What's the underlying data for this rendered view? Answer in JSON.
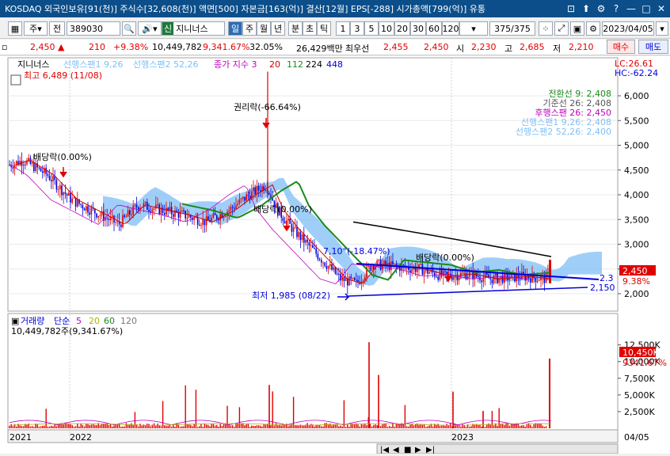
{
  "title_bar": {
    "text": "KOSDAQ 외국인보유[91(천)] 주식수[32,608(천)] 액면[500] 자본금[163(억)] 결산[12월] EPS[-288] 시가총액[799(억)] 유통",
    "buttons": [
      "restore-icon",
      "pin-icon",
      "settings-icon",
      "help-icon",
      "minimize-icon",
      "maximize-icon",
      "close-icon"
    ],
    "button_glyphs": [
      "⊡",
      "⬆",
      "⚙",
      "?",
      "—",
      "□",
      "✕"
    ]
  },
  "toolbar": {
    "code": "389030",
    "stock_name": "지니너스",
    "jeon_label": "전",
    "ju_label": "주",
    "sin_label": "신",
    "periods": [
      "일",
      "주",
      "월",
      "년",
      "분",
      "초",
      "틱"
    ],
    "active_period": "일",
    "intervals": [
      "1",
      "3",
      "5",
      "10",
      "20",
      "30",
      "60",
      "120"
    ],
    "page_count": "375/375",
    "date": "2023/04/05",
    "buy_label": "매수",
    "sell_label": "매도"
  },
  "quote": {
    "price": "2,450",
    "arrow": "▲",
    "change": "210",
    "change_pct": "+9.38%",
    "volume": "10,449,782",
    "volume_ratio": "9,341.67%",
    "turnover": "32.05%",
    "amount": "26,429백만",
    "priority_label": "최우선",
    "bid": "2,455",
    "ask": "2,450",
    "open_label": "시",
    "open": "2,230",
    "high_label": "고",
    "high": "2,685",
    "low_label": "저",
    "low": "2,210"
  },
  "chart_legend": {
    "name": "지니너스",
    "span1": "선행스팬1 9,26",
    "span2": "선행스팬2 52,26",
    "close_label": "종가 지수 3",
    "ma1": "20",
    "ma2": "112",
    "ma3": "224",
    "ma4": "448",
    "lc": "LC:26.61",
    "hc": "HC:-62.24",
    "high_note": "최고 6,489 (11/08)",
    "low_note": "최저 1,985 (08/22)"
  },
  "ichimoku_labels": {
    "conversion": "전환선 9: 2,408",
    "base": "기준선 26: 2,408",
    "lagging": "후행스팬 26: 2,450",
    "span1": "선행스팬1 9,26: 2,408",
    "span2": "선행스팬2 52,26: 2,400"
  },
  "annotations": {
    "rights_drop": "권리락(-66.64%)",
    "dividend1": "배당락(0.00%)",
    "dividend2": "배당락(0.00%)",
    "dividend3": "배당락(0.00%)",
    "level_710": "7,10°(-18.47%)",
    "right_23": "2.3",
    "right_2150": "2,150"
  },
  "price_axis": {
    "ticks": [
      "6,000",
      "5,500",
      "5,000",
      "4,500",
      "4,000",
      "3,500",
      "3,000",
      "2,500",
      "2,000"
    ],
    "current": "2,450",
    "current_pct": "9.38%"
  },
  "volume_legend": {
    "label": "거래량",
    "simple": "단순",
    "ma5": "5",
    "ma20": "20",
    "ma60": "60",
    "ma120": "120",
    "value": "10,449,782주(9,341.67%)"
  },
  "volume_axis": {
    "ticks": [
      "12,500K",
      "10,000K",
      "7,500K",
      "5,000K",
      "2,500K"
    ],
    "current": "10,450K",
    "current_pct": "9341.67%"
  },
  "x_axis": {
    "labels": [
      "2021",
      "2022",
      "2023"
    ],
    "right_label": "04/05"
  },
  "colors": {
    "title_bg": "#0b4e8a",
    "up": "#e00000",
    "down": "#0000d8",
    "cloud": "#7fbff5",
    "ma_green": "#1a8a1a",
    "ma_black": "#000000"
  }
}
